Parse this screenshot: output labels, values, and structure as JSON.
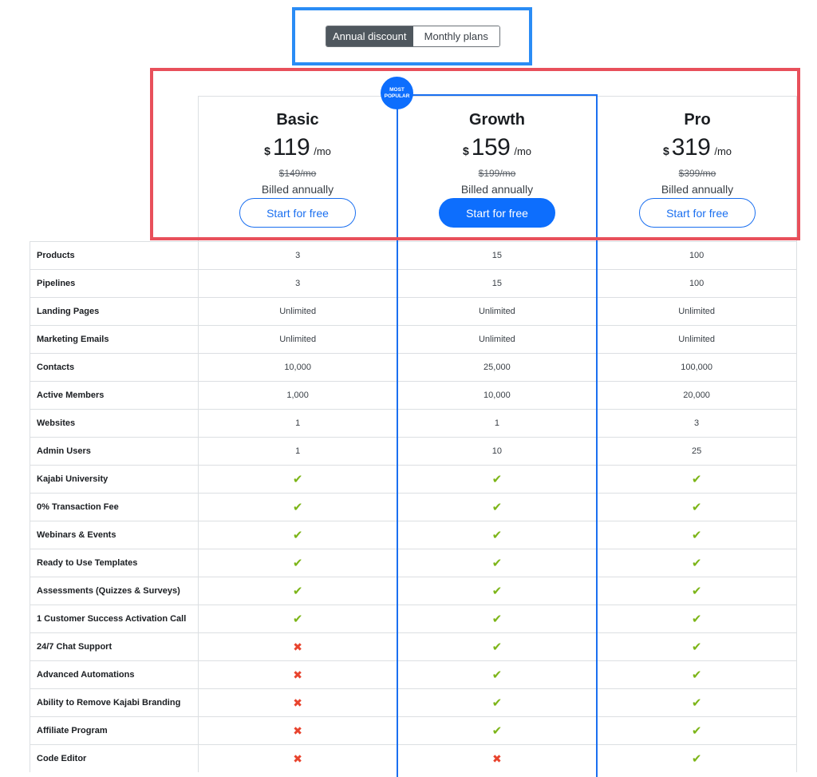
{
  "toggle": {
    "annual_label": "Annual discount",
    "monthly_label": "Monthly plans",
    "selected": "Annual discount"
  },
  "badge": {
    "line1": "MOST",
    "line2": "POPULAR"
  },
  "plans": [
    {
      "name": "Basic",
      "currency": "$",
      "price": "119",
      "per": "/mo",
      "old_price": "$149/mo",
      "billed": "Billed annually",
      "cta": "Start for free"
    },
    {
      "name": "Growth",
      "currency": "$",
      "price": "159",
      "per": "/mo",
      "old_price": "$199/mo",
      "billed": "Billed annually",
      "cta": "Start for free"
    },
    {
      "name": "Pro",
      "currency": "$",
      "price": "319",
      "per": "/mo",
      "old_price": "$399/mo",
      "billed": "Billed annually",
      "cta": "Start for free"
    }
  ],
  "features": [
    {
      "label": "Products",
      "values": [
        "3",
        "15",
        "100"
      ]
    },
    {
      "label": "Pipelines",
      "values": [
        "3",
        "15",
        "100"
      ]
    },
    {
      "label": "Landing Pages",
      "values": [
        "Unlimited",
        "Unlimited",
        "Unlimited"
      ]
    },
    {
      "label": "Marketing Emails",
      "values": [
        "Unlimited",
        "Unlimited",
        "Unlimited"
      ]
    },
    {
      "label": "Contacts",
      "values": [
        "10,000",
        "25,000",
        "100,000"
      ]
    },
    {
      "label": "Active Members",
      "values": [
        "1,000",
        "10,000",
        "20,000"
      ]
    },
    {
      "label": "Websites",
      "values": [
        "1",
        "1",
        "3"
      ]
    },
    {
      "label": "Admin Users",
      "values": [
        "1",
        "10",
        "25"
      ]
    },
    {
      "label": "Kajabi University",
      "values": [
        "check",
        "check",
        "check"
      ]
    },
    {
      "label": "0% Transaction Fee",
      "values": [
        "check",
        "check",
        "check"
      ]
    },
    {
      "label": "Webinars & Events",
      "values": [
        "check",
        "check",
        "check"
      ]
    },
    {
      "label": "Ready to Use Templates",
      "values": [
        "check",
        "check",
        "check"
      ]
    },
    {
      "label": "Assessments (Quizzes & Surveys)",
      "values": [
        "check",
        "check",
        "check"
      ]
    },
    {
      "label": "1 Customer Success Activation Call",
      "values": [
        "check",
        "check",
        "check"
      ]
    },
    {
      "label": "24/7 Chat Support",
      "values": [
        "cross",
        "check",
        "check"
      ]
    },
    {
      "label": "Advanced Automations",
      "values": [
        "cross",
        "check",
        "check"
      ]
    },
    {
      "label": "Ability to Remove Kajabi Branding",
      "values": [
        "cross",
        "check",
        "check"
      ]
    },
    {
      "label": "Affiliate Program",
      "values": [
        "cross",
        "check",
        "check"
      ]
    },
    {
      "label": "Code Editor",
      "values": [
        "cross",
        "cross",
        "check"
      ]
    }
  ],
  "icons": {
    "included": "check-icon",
    "excluded": "cross-icon"
  },
  "colors": {
    "accent": "#0d6efd",
    "check": "#7cb518",
    "cross": "#e8432d",
    "toggle_active": "#4f575e"
  }
}
